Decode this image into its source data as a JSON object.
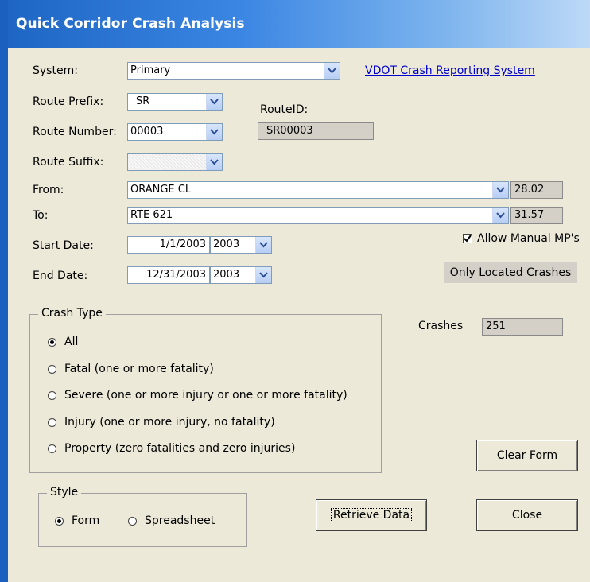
{
  "window": {
    "title": "Quick Corridor Crash Analysis"
  },
  "labels": {
    "system": "System:",
    "route_prefix": "Route Prefix:",
    "route_number": "Route Number:",
    "route_suffix": "Route Suffix:",
    "from": "From:",
    "to": "To:",
    "start_date": "Start Date:",
    "end_date": "End Date:",
    "route_id": "RouteID:",
    "crashes": "Crashes"
  },
  "fields": {
    "system": "Primary",
    "route_prefix": "SR",
    "route_number": "00003",
    "route_suffix": "",
    "route_id": "SR00003",
    "from": "ORANGE CL",
    "from_mp": "28.02",
    "to": "RTE 621",
    "to_mp": "31.57",
    "start_date": "1/1/2003",
    "start_year": "2003",
    "end_date": "12/31/2003",
    "end_year": "2003",
    "crashes": "251"
  },
  "link": {
    "label": "VDOT Crash Reporting System"
  },
  "allow_manual": {
    "label": "Allow Manual MP's",
    "checked": true
  },
  "only_located": "Only Located Crashes",
  "crash_type": {
    "legend": "Crash Type",
    "options": [
      {
        "label": "All",
        "selected": true
      },
      {
        "label": "Fatal (one or more fatality)",
        "selected": false
      },
      {
        "label": "Severe (one or more injury or one or more fatality)",
        "selected": false
      },
      {
        "label": "Injury (one or more injury, no fatality)",
        "selected": false
      },
      {
        "label": "Property (zero fatalities and zero injuries)",
        "selected": false
      }
    ]
  },
  "style": {
    "legend": "Style",
    "options": [
      {
        "label": "Form",
        "selected": true
      },
      {
        "label": "Spreadsheet",
        "selected": false
      }
    ]
  },
  "buttons": {
    "clear": "Clear Form",
    "retrieve": "Retrieve Data",
    "close": "Close"
  },
  "colors": {
    "title_bar_start": "#1e66c4",
    "dialog_bg": "#ece9d8",
    "link": "#0000cc"
  },
  "icons": [
    "chevron-down-icon",
    "checkmark-icon",
    "radio-icon"
  ]
}
